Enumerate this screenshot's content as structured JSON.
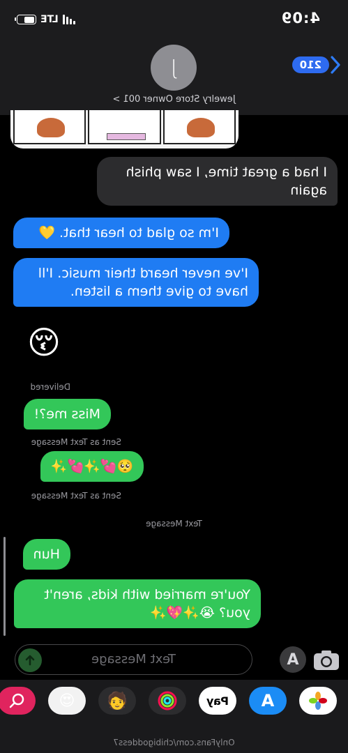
{
  "status_bar": {
    "time": "4:09",
    "network": "LTE",
    "battery_level": 0.65
  },
  "header": {
    "back_badge": "210",
    "avatar_initial": "J",
    "contact_name": "Jewelry Store Owner 001 >"
  },
  "messages": {
    "m1": "I had a great time, I saw phish again",
    "m2": "I'm so glad to hear that. 💛",
    "m3": "I've never heard their music. I'll have to give them a listen.",
    "m4": "😚",
    "delivered": "Delivered",
    "m5": "Miss me?!",
    "sent_as_1": "Sent as Text Message",
    "m6": "🥺💕✨💕✨",
    "sent_as_2": "Sent as Text Message",
    "divider": "Text Message",
    "m7": "Hun",
    "m8": "You're married with kids, aren't you? 😭✨💖✨"
  },
  "composer": {
    "placeholder": "Text Message"
  },
  "app_drawer": {
    "apple_pay_label": "Pay"
  },
  "footer": {
    "watermark": "OnlyFans.com/chibigoddess7"
  },
  "colors": {
    "blue_bubble": "#1f7cf3",
    "green_bubble": "#33c759",
    "gray_bubble": "#2c2c2e",
    "badge": "#2e6bf0"
  },
  "icons": [
    "back-chevron-icon",
    "camera-icon",
    "app-store-icon",
    "send-arrow-icon",
    "photos-icon",
    "apple-pay-icon",
    "activity-icon",
    "memoji-icon",
    "search-images-icon"
  ]
}
